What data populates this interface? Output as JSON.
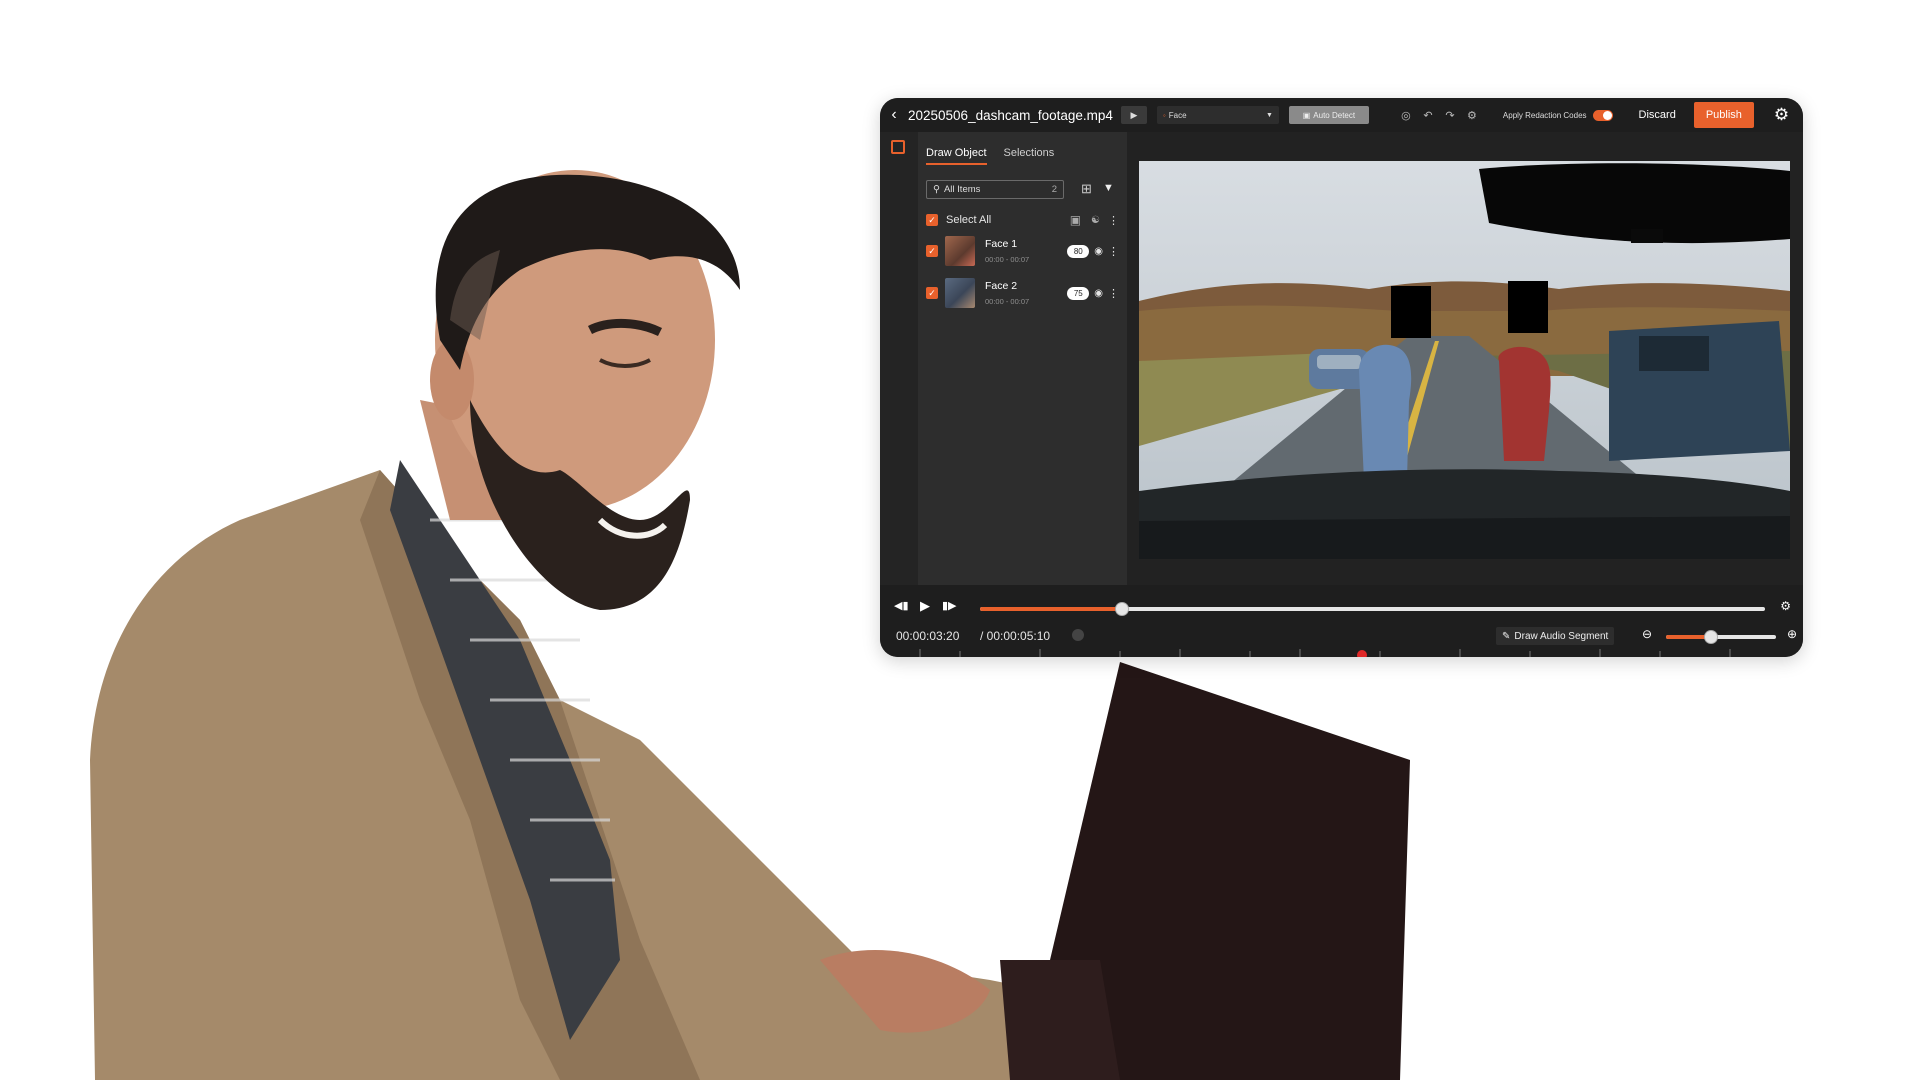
{
  "editor": {
    "filename": "20250506_dashcam_footage.mp4",
    "toolbar": {
      "object_type": "Face",
      "auto_detect_label": "Auto Detect",
      "apply_redaction_label": "Apply Redaction Codes",
      "apply_redaction_on": true,
      "discard_label": "Discard",
      "publish_label": "Publish"
    },
    "panel": {
      "tabs": [
        "Draw Object",
        "Selections"
      ],
      "active_tab": "Draw Object",
      "search_placeholder": "All Items",
      "item_count": "2",
      "select_all_label": "Select All",
      "items": [
        {
          "name": "Face 1",
          "range": "00:00 - 00:07",
          "score": "80"
        },
        {
          "name": "Face 2",
          "range": "00:00 - 00:07",
          "score": "75"
        }
      ]
    },
    "player": {
      "current_time": "00:00:03:20",
      "total_time": "/ 00:00:05:10",
      "progress_fraction": 0.18,
      "draw_audio_label": "Draw Audio Segment",
      "zoom_fraction": 0.4
    }
  },
  "colors": {
    "accent": "#e8612c",
    "window_bg": "#2b2b2b",
    "toolbar_bg": "#1e1e1e"
  }
}
